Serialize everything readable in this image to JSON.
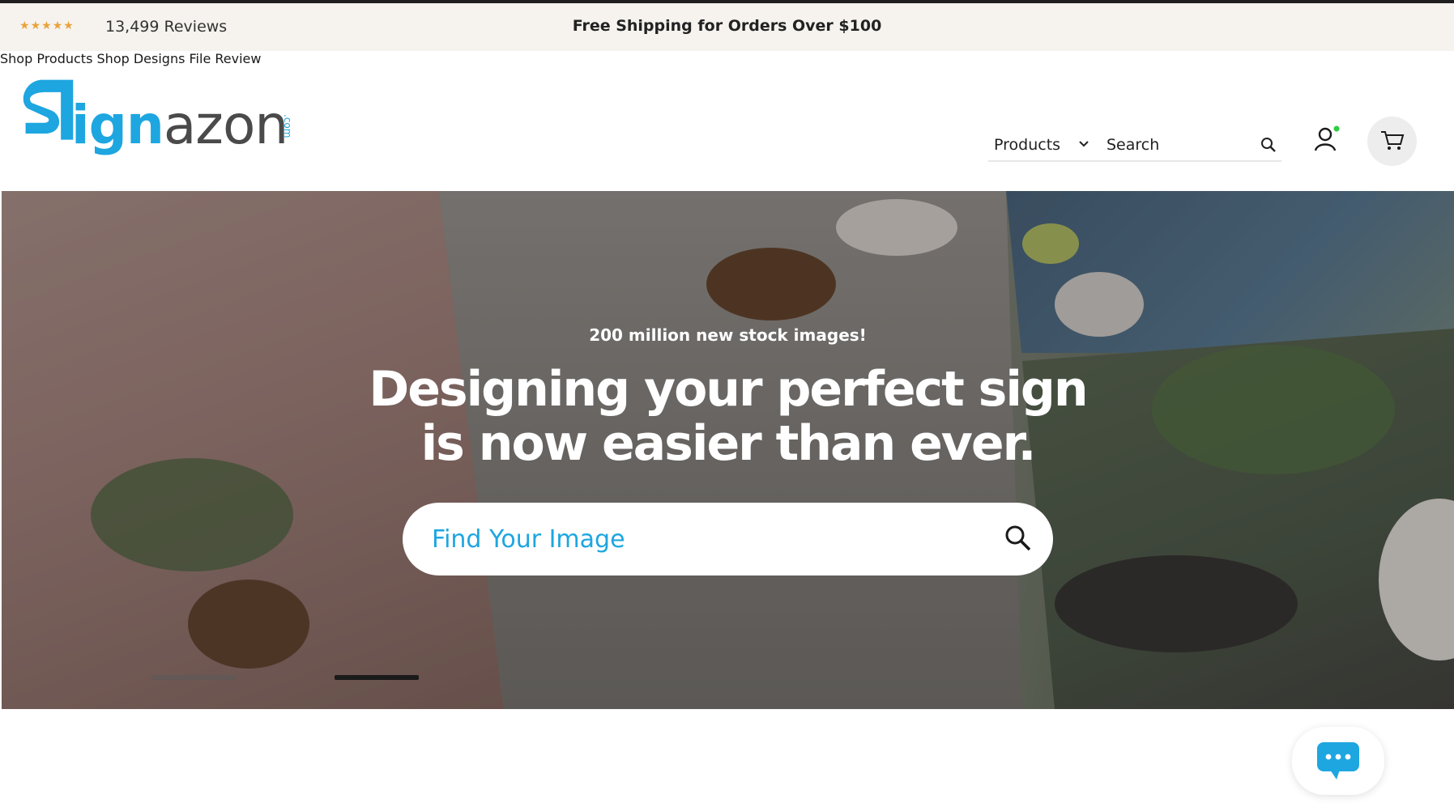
{
  "announcement": {
    "stars_icon": "star-rating-icon",
    "rating": "4.5",
    "review_count": "13,499 Reviews",
    "shipping_message": "Free Shipping for Orders Over $100"
  },
  "brand": {
    "logo_first": "ign",
    "logo_rest": "azon",
    "logo_suffix": ".com",
    "brand_color": "#1da6e0"
  },
  "nav": {
    "items": [
      {
        "label": "Shop Products"
      },
      {
        "label": "Shop Designs"
      },
      {
        "label": "File Review"
      }
    ]
  },
  "search": {
    "category": "Products",
    "placeholder": "Search"
  },
  "header_icons": {
    "account": "user-icon",
    "cart": "cart-icon"
  },
  "hero": {
    "kicker": "200 million new stock images!",
    "title_line1": "Designing your perfect sign",
    "title_line2": "is now easier than ever.",
    "search_placeholder": "Find Your Image",
    "slides_total": 2,
    "active_slide": 2
  },
  "chat": {
    "icon": "chat-bubble-icon"
  }
}
